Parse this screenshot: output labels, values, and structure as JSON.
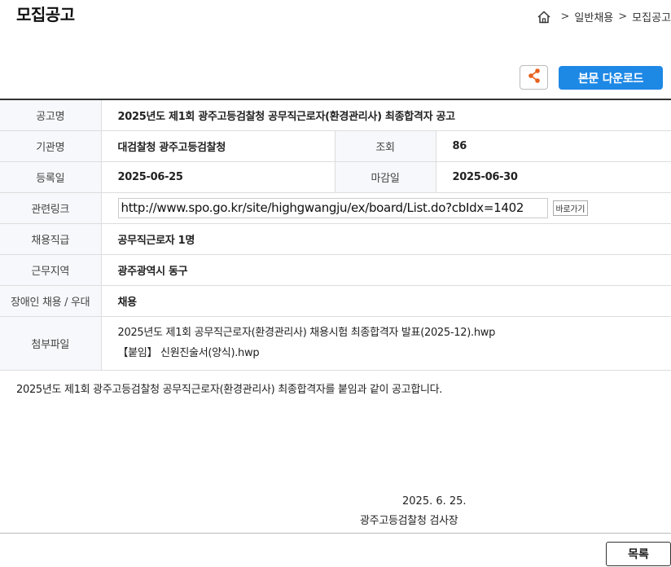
{
  "header": {
    "title": "모집공고",
    "breadcrumb": [
      "일반채용",
      "모집공고"
    ],
    "breadcrumb_sep": ">"
  },
  "actions": {
    "share_icon": "share-icon",
    "download_label": "본문 다운로드",
    "accent_color": "#1e88e5"
  },
  "info": {
    "title_label": "공고명",
    "title_value": "2025년도 제1회 광주고등검찰청 공무직근로자(환경관리사) 최종합격자 공고",
    "agency_label": "기관명",
    "agency_value": "대검찰청 광주고등검찰청",
    "views_label": "조회",
    "views_value": "86",
    "reg_label": "등록일",
    "reg_value": "2025-06-25",
    "deadline_label": "마감일",
    "deadline_value": "2025-06-30",
    "link_label": "관련링크",
    "link_value": "http://www.spo.go.kr/site/highgwangju/ex/board/List.do?cbIdx=1402",
    "go_label": "바로가기",
    "job_label": "채용직급",
    "job_value": "공무직근로자 1명",
    "region_label": "근무지역",
    "region_value": "광주광역시 동구",
    "disabled_label": "장애인 채용 / 우대",
    "disabled_value": "채용",
    "files_label": "첨부파일",
    "files": [
      "2025년도 제1회 공무직근로자(환경관리사) 채용시험 최종합격자 발표(2025-12).hwp",
      "【붙임】 신원진술서(양식).hwp"
    ]
  },
  "body": {
    "text": "2025년도 제1회 광주고등검찰청 공무직근로자(환경관리사) 최종합격자를 붙임과 같이 공고합니다.",
    "date": "2025. 6. 25.",
    "signer": "광주고등검찰청 검사장"
  },
  "footer": {
    "list_label": "목록"
  }
}
